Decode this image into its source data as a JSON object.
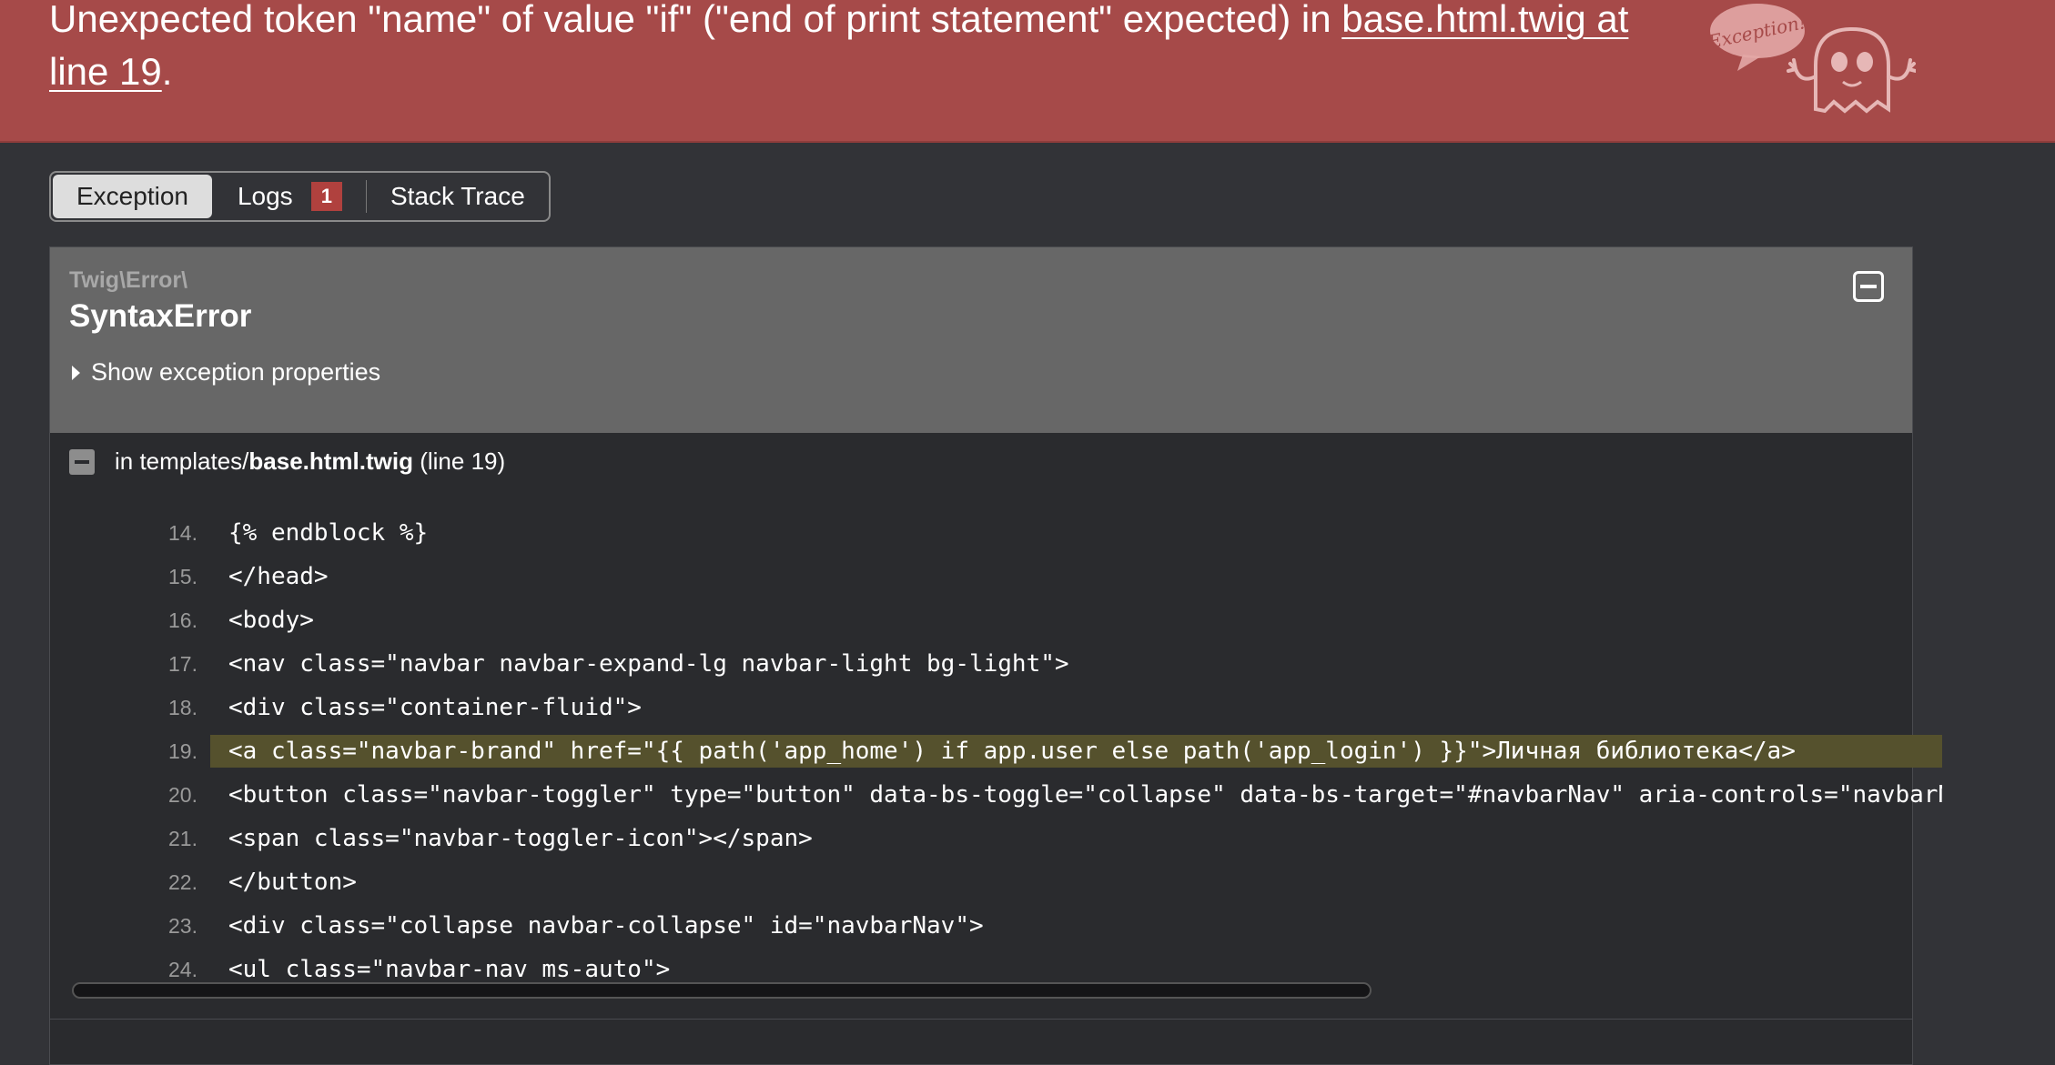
{
  "header": {
    "message_prefix": "Unexpected token \"name\" of value \"if\" (\"end of print statement\" expected) in ",
    "message_link": "base.html.twig at line 19",
    "message_suffix": ".",
    "illustration_text": "Exception!"
  },
  "tabs": [
    {
      "label": "Exception",
      "active": true
    },
    {
      "label": "Logs",
      "badge": "1"
    },
    {
      "label": "Stack Trace"
    }
  ],
  "exception": {
    "namespace": "Twig\\Error\\",
    "class_name": "SyntaxError",
    "show_properties_label": "Show exception properties"
  },
  "trace": {
    "in_label": "in templates/",
    "file_name": "base.html.twig",
    "line_info": "(line 19)"
  },
  "code_lines": [
    {
      "no": "14.",
      "code": "{% endblock %}"
    },
    {
      "no": "15.",
      "code": "</head>"
    },
    {
      "no": "16.",
      "code": "<body>"
    },
    {
      "no": "17.",
      "code": "<nav class=\"navbar navbar-expand-lg navbar-light bg-light\">"
    },
    {
      "no": "18.",
      "code": "<div class=\"container-fluid\">"
    },
    {
      "no": "19.",
      "code": "<a class=\"navbar-brand\" href=\"{{ path('app_home') if app.user else path('app_login') }}\">Личная библиотека</a>",
      "selected": true
    },
    {
      "no": "20.",
      "code": "<button class=\"navbar-toggler\" type=\"button\" data-bs-toggle=\"collapse\" data-bs-target=\"#navbarNav\" aria-controls=\"navbarN"
    },
    {
      "no": "21.",
      "code": "<span class=\"navbar-toggler-icon\"></span>"
    },
    {
      "no": "22.",
      "code": "</button>"
    },
    {
      "no": "23.",
      "code": "<div class=\"collapse navbar-collapse\" id=\"navbarNav\">"
    },
    {
      "no": "24.",
      "code": "<ul class=\"navbar-nav ms-auto\">"
    }
  ],
  "colors": {
    "header_bg": "#a64a49",
    "page_bg": "#323337",
    "panel_head_bg": "#676767",
    "highlight_bg": "#55512d",
    "badge_bg": "#b0413e"
  }
}
